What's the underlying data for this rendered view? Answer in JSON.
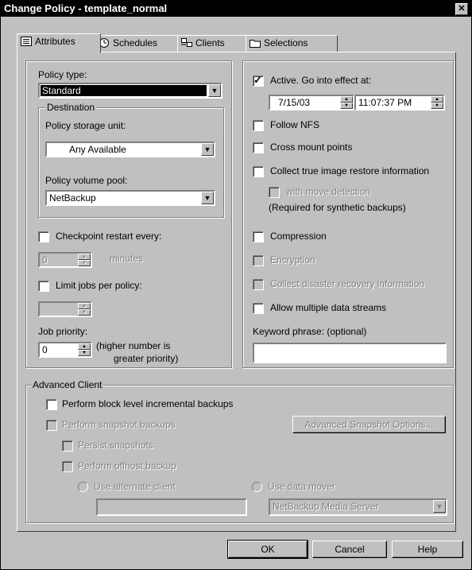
{
  "window": {
    "title": "Change Policy - template_normal",
    "close_glyph": "✕"
  },
  "tabs": [
    {
      "label": "Attributes",
      "icon": "list-icon"
    },
    {
      "label": "Schedules",
      "icon": "clock-icon"
    },
    {
      "label": "Clients",
      "icon": "computers-icon"
    },
    {
      "label": "Selections",
      "icon": "folder-icon"
    }
  ],
  "left": {
    "policy_type_label": "Policy type:",
    "policy_type_value": "Standard",
    "destination_legend": "Destination",
    "storage_unit_label": "Policy storage unit:",
    "storage_unit_value": "Any Available",
    "volume_pool_label": "Policy volume pool:",
    "volume_pool_value": "NetBackup",
    "checkpoint_label": "Checkpoint restart every:",
    "checkpoint_value": "0",
    "minutes_label": "minutes",
    "limit_jobs_label": "Limit jobs per policy:",
    "limit_jobs_value": "",
    "job_priority_label": "Job priority:",
    "job_priority_value": "0",
    "priority_hint_1": "(higher number is",
    "priority_hint_2": "greater priority)"
  },
  "right": {
    "active_label": "Active. Go into effect at:",
    "active_checked": true,
    "date_value": "7/15/03",
    "time_value": "11:07:37 PM",
    "follow_nfs": "Follow NFS",
    "cross_mount": "Cross mount points",
    "collect_tir": "Collect true image restore information",
    "move_detection": "with move detection",
    "synthetic_note": "(Required for synthetic backups)",
    "compression": "Compression",
    "encryption": "Encryption",
    "collect_dr": "Collect disaster recovery information",
    "multi_streams": "Allow multiple data streams",
    "keyword_label": "Keyword phrase: (optional)",
    "keyword_value": ""
  },
  "advanced": {
    "legend": "Advanced Client",
    "block_level": "Perform block level incremental backups",
    "snapshot": "Perform snapshot backups",
    "snapshot_options_button": "Advanced Snapshot Options...",
    "persist": "Persist snapshots",
    "offhost": "Perform offhost backup",
    "alt_client": "Use alternate client",
    "alt_client_value": "",
    "data_mover": "Use data mover",
    "data_mover_value": "NetBackup Media Server"
  },
  "buttons": {
    "ok": "OK",
    "cancel": "Cancel",
    "help": "Help"
  }
}
